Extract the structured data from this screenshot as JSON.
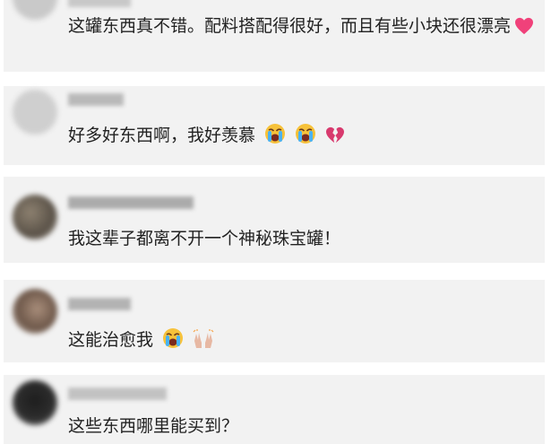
{
  "comments": [
    {
      "text": "这罐东西真不错。配料搭配得很好，而且有些小块还很漂亮",
      "emojis": [
        "pink-heart"
      ]
    },
    {
      "text": "好多好东西啊，我好羡慕",
      "emojis": [
        "loudly-crying-face",
        "loudly-crying-face",
        "broken-heart"
      ]
    },
    {
      "text": "我这辈子都离不开一个神秘珠宝罐！",
      "emojis": []
    },
    {
      "text": "这能治愈我",
      "emojis": [
        "loudly-crying-face",
        "raising-hands"
      ]
    },
    {
      "text": "这些东西哪里能买到？",
      "emojis": []
    }
  ],
  "colors": {
    "card_background": "#f2f2f2",
    "comment_text": "#222222",
    "heart_pink": "#f0417a",
    "broken_heart": "#d83a6e"
  }
}
